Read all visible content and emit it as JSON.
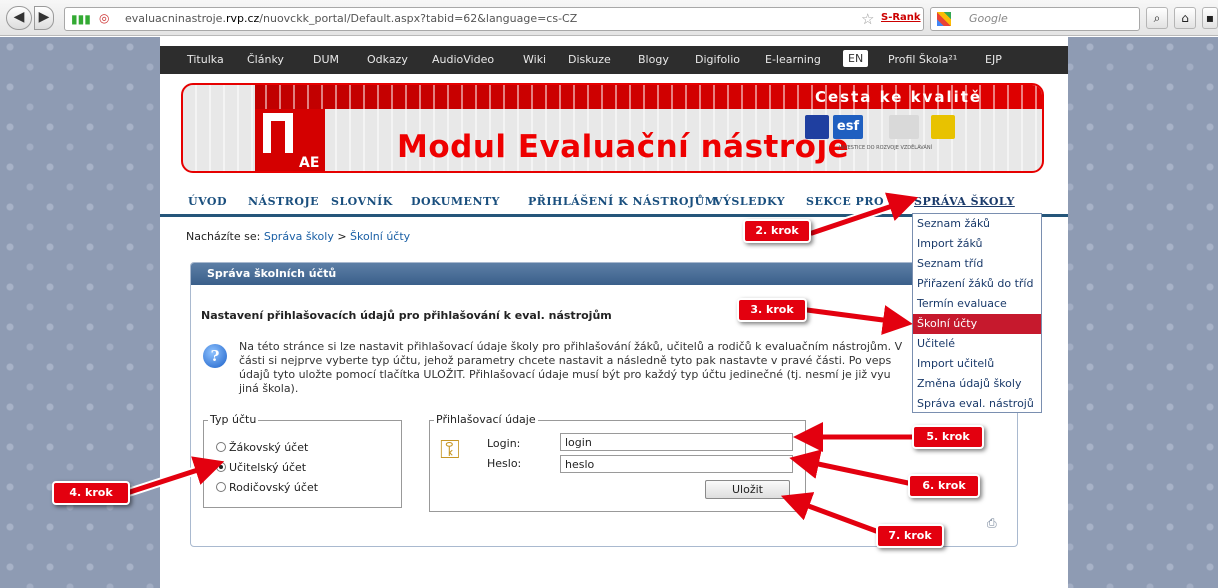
{
  "browser": {
    "url_prefix": "evaluacninastroje.",
    "url_domain": "rvp.cz",
    "url_suffix": "/nuovckk_portal/Default.aspx?tabid=62&language=cs-CZ",
    "srank": "S-Rank",
    "search_placeholder": "Google",
    "back": "◀",
    "forward": "▶"
  },
  "topnav": [
    "Titulka",
    "Články",
    "DUM",
    "Odkazy",
    "AudioVideo",
    "Wiki",
    "Diskuze",
    "Blogy",
    "Digifolio",
    "E-learning",
    "EN",
    "Profil Škola²¹",
    "EJP"
  ],
  "banner": {
    "tagline": "Cesta ke kvalitě",
    "title": "Modul Evaluační nástroje",
    "pae": "AE",
    "eu_note": "INVESTICE DO ROZVOJE VZDĚLÁVÁNÍ",
    "esf": "esf"
  },
  "mainmenu": [
    "ÚVOD",
    "NÁSTROJE",
    "SLOVNÍK",
    "DOKUMENTY",
    "PŘIHLÁŠENÍ K NÁSTROJŮM",
    "VÝSLEDKY",
    "SEKCE PRO",
    "SPRÁVA ŠKOLY"
  ],
  "breadcrumb": {
    "prefix": "Nacházíte se:",
    "level1": "Správa školy",
    "sep": ">",
    "level2": "Školní účty"
  },
  "panel": {
    "header": "Správa školních účtů",
    "subheading": "Nastavení přihlašovacích údajů pro přihlašování k eval. nástrojům",
    "info_line1": "Na této stránce si lze nastavit přihlašovací údaje školy pro přihlašování žáků, učitelů a rodičů k evaluačním nástrojům. V",
    "info_line2": "části si nejprve vyberte typ účtu, jehož parametry chcete nastavit a následně tyto pak nastavte v pravé části. Po veps",
    "info_line3": "údajů tyto uložte pomocí tlačítka ULOŽIT. Přihlašovací údaje musí být pro každý typ účtu jedinečné (tj. nesmí je již vyu",
    "info_line4": "jiná škola).",
    "account_type_legend": "Typ účtu",
    "account_types": [
      "Žákovský účet",
      "Učitelský účet",
      "Rodičovský účet"
    ],
    "selected_account_type": "Učitelský účet",
    "credentials_legend": "Přihlašovací údaje",
    "login_label": "Login:",
    "login_value": "login",
    "password_label": "Heslo:",
    "password_value": "heslo",
    "save_button": "Uložit"
  },
  "dropdown": [
    "Seznam žáků",
    "Import žáků",
    "Seznam tříd",
    "Přiřazení žáků do tříd",
    "Termín evaluace",
    "Školní účty",
    "Učitelé",
    "Import učitelů",
    "Změna údajů školy",
    "Správa eval. nástrojů"
  ],
  "dropdown_active": "Školní účty",
  "annotations": [
    "2. krok",
    "3. krok",
    "4. krok",
    "5. krok",
    "6. krok",
    "7. krok"
  ],
  "colors": {
    "accent_red": "#e3000f",
    "nav_dark": "#2d2d2d",
    "menu_blue": "#1a4f7e",
    "panel_header": "#3a5f8a"
  }
}
